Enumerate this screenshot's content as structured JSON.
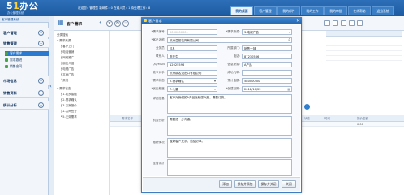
{
  "header": {
    "logo_main": "5",
    "logo_accent": "1",
    "logo_rest": "办公",
    "logo_sub": "办公管理系统",
    "info": "欢迎您：管理员  新邮件：0  在线人员：1  待处理工作：8",
    "tabs": [
      "我的桌面",
      "客户管理",
      "我的邮件",
      "我的工作",
      "我的审批",
      "在线帮助",
      "退出系统"
    ],
    "active_tab": 0
  },
  "sidebar": {
    "title": "客户管理系统",
    "groups": [
      {
        "label": "客户管理",
        "toggle": "−"
      },
      {
        "label": "销售管理",
        "toggle": "−",
        "items": [
          {
            "label": "客户需求",
            "active": true
          },
          {
            "label": "需求跟进",
            "active": false
          },
          {
            "label": "销售合同",
            "active": false
          }
        ]
      },
      {
        "label": "市场信息",
        "toggle": "+"
      },
      {
        "label": "销售资料",
        "toggle": "+"
      },
      {
        "label": "统计分析",
        "toggle": "+"
      }
    ]
  },
  "main": {
    "tab_title": "客户需求",
    "tree": [
      "分类搜索",
      "─ 需求来源",
      "├ 客户上门",
      "├ 电话营销",
      "├ 网络推广",
      "├ 朋友介绍",
      "├ 电视广告",
      "├ 平面广告",
      "└ 其他",
      "─ 需求状态",
      "├ 1-初步接触",
      "├ 2-需求确认",
      "├ 3-方案报价",
      "├ 4-合同签订",
      "└ 5-无效需求"
    ],
    "list_headers": [
      "",
      "需求名称",
      "需求",
      "客户",
      "状态",
      "时间",
      "报价金额"
    ],
    "list_row": [
      "",
      "",
      "",
      "",
      "",
      "",
      "0.00"
    ]
  },
  "dialog": {
    "title": "客户需求",
    "fields": {
      "demand_no_label": "*需求编号:",
      "demand_no_placeholder": "0000000001",
      "source_label": "*需求来源:",
      "source_value": "3-电视广告",
      "customer_label": "*客户名称:",
      "customer_value": "杭州温馨装饰有限公司",
      "company_label": "业务员:",
      "company_value": "吕礼",
      "dept_label": "所属部门:",
      "dept_value": "销售一部",
      "contact_label": "联系人:",
      "contact_value": "陈先生",
      "phone_label": "电话:",
      "phone_value": "87230566",
      "qq_label": "QQ/MSN:",
      "qq_value": "12025596",
      "source2_label": "信息来源:",
      "source2_value": "A产品",
      "rival_label": "竞争对手:",
      "rival_value": "杭州群名进出口有限公司",
      "success_label": "成功几率:",
      "success_value": "",
      "status_label": "*需求状态:",
      "status_value": "2-需求确认",
      "amount_label": "预计金额:",
      "amount_value": "580000.00",
      "level_label": "*优先程度:",
      "level_value": "7-七星",
      "date_label": "*创建日期:",
      "date_value": "2012/10/22",
      "desc_label": "详细信息:",
      "desc_value": "客户对我们的A产品比较感兴趣，需要订货。",
      "opp_label": "机会分析:",
      "opp_value": "需要进一步沟通。",
      "track_label": "跟踪情况:",
      "track_value": "做好客户关系，追加订单。",
      "remark_label": "主管评价:",
      "remark_value": ""
    },
    "buttons": [
      "添加",
      "保存并添加",
      "保存并关闭",
      "关闭"
    ]
  },
  "colors": {
    "header": "#2d6fb8",
    "dialog_header": "#3d87d4",
    "accent": "#2b7ad0",
    "logo_accent": "#ffd23a"
  }
}
